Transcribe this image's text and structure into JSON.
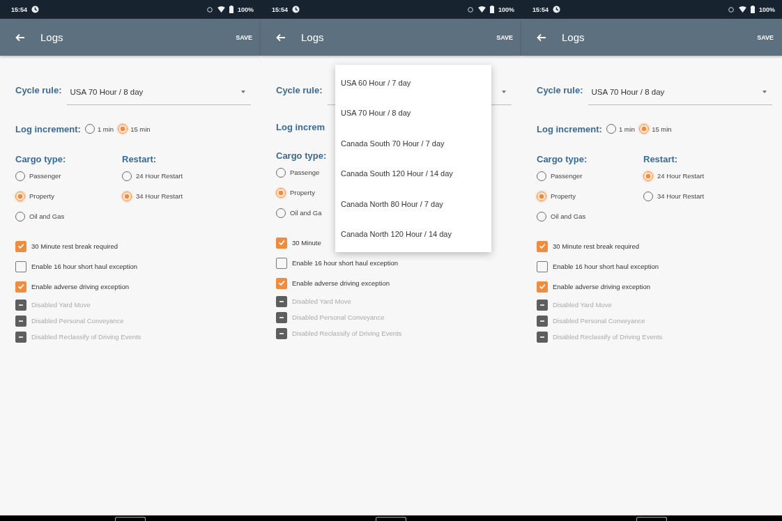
{
  "screens": [
    {
      "status_bar": {
        "time": "15:54",
        "battery": "100%"
      },
      "app_bar": {
        "title": "Logs",
        "action": "SAVE"
      },
      "cycle_rule": {
        "label": "Cycle rule:",
        "value": "USA 70 Hour / 8 day"
      },
      "log_increment": {
        "label": "Log increment:",
        "options": [
          {
            "label": "1 min",
            "selected": false
          },
          {
            "label": "15 min",
            "selected": true
          }
        ]
      },
      "cargo_type": {
        "label": "Cargo type:",
        "options": [
          {
            "label": "Passenger",
            "selected": false
          },
          {
            "label": "Property",
            "selected": true
          },
          {
            "label": "Oil and Gas",
            "selected": false
          }
        ]
      },
      "restart": {
        "label": "Restart:",
        "options": [
          {
            "label": "24 Hour Restart",
            "selected": false
          },
          {
            "label": "34 Hour Restart",
            "selected": true
          }
        ]
      },
      "checkboxes": [
        {
          "label": "30 Minute rest break required",
          "checked": true,
          "disabled": false
        },
        {
          "label": "Enable 16 hour short haul exception",
          "checked": false,
          "disabled": false
        },
        {
          "label": "Enable adverse driving exception",
          "checked": true,
          "disabled": false
        },
        {
          "label": "Disabled Yard Move",
          "disabled": true
        },
        {
          "label": "Disabled Personal Conveyance",
          "disabled": true
        },
        {
          "label": "Disabled Reclassify of Driving Events",
          "disabled": true
        }
      ]
    },
    {
      "status_bar": {
        "time": "15:54",
        "battery": "100%"
      },
      "app_bar": {
        "title": "Logs",
        "action": "SAVE"
      },
      "cycle_rule": {
        "label": "Cycle rule:"
      },
      "log_increment": {
        "label": "Log increm"
      },
      "cargo_type": {
        "label": "Cargo type:",
        "options": [
          {
            "label": "Passenge",
            "selected": false
          },
          {
            "label": "Property",
            "selected": true
          },
          {
            "label": "Oil and Ga",
            "selected": false
          }
        ]
      },
      "checkboxes": [
        {
          "label": "30 Minute",
          "checked": true,
          "disabled": false
        },
        {
          "label": "Enable 16 hour short haul exception",
          "checked": false,
          "disabled": false
        },
        {
          "label": "Enable adverse driving exception",
          "checked": true,
          "disabled": false
        },
        {
          "label": "Disabled Yard Move",
          "disabled": true
        },
        {
          "label": "Disabled Personal Conveyance",
          "disabled": true
        },
        {
          "label": "Disabled Reclassify of Driving Events",
          "disabled": true
        }
      ],
      "dropdown_menu": [
        "USA 60 Hour / 7 day",
        "USA 70 Hour / 8 day",
        "Canada South 70 Hour / 7 day",
        "Canada South 120 Hour / 14 day",
        "Canada North 80 Hour / 7 day",
        "Canada North 120 Hour / 14 day"
      ]
    },
    {
      "status_bar": {
        "time": "15:54",
        "battery": "100%"
      },
      "app_bar": {
        "title": "Logs",
        "action": "SAVE"
      },
      "cycle_rule": {
        "label": "Cycle rule:",
        "value": "USA 70 Hour / 8 day"
      },
      "log_increment": {
        "label": "Log increment:",
        "options": [
          {
            "label": "1 min",
            "selected": false
          },
          {
            "label": "15 min",
            "selected": true
          }
        ]
      },
      "cargo_type": {
        "label": "Cargo type:",
        "options": [
          {
            "label": "Passenger",
            "selected": false
          },
          {
            "label": "Property",
            "selected": true
          },
          {
            "label": "Oil and Gas",
            "selected": false
          }
        ]
      },
      "restart": {
        "label": "Restart:",
        "options": [
          {
            "label": "24 Hour Restart",
            "selected": true
          },
          {
            "label": "34 Hour Restart",
            "selected": false
          }
        ]
      },
      "checkboxes": [
        {
          "label": "30 Minute rest break required",
          "checked": true,
          "disabled": false
        },
        {
          "label": "Enable 16 hour short haul exception",
          "checked": false,
          "disabled": false
        },
        {
          "label": "Enable adverse driving exception",
          "checked": true,
          "disabled": false
        },
        {
          "label": "Disabled Yard Move",
          "disabled": true
        },
        {
          "label": "Disabled Personal Conveyance",
          "disabled": true
        },
        {
          "label": "Disabled Reclassify of Driving Events",
          "disabled": true
        }
      ]
    }
  ]
}
